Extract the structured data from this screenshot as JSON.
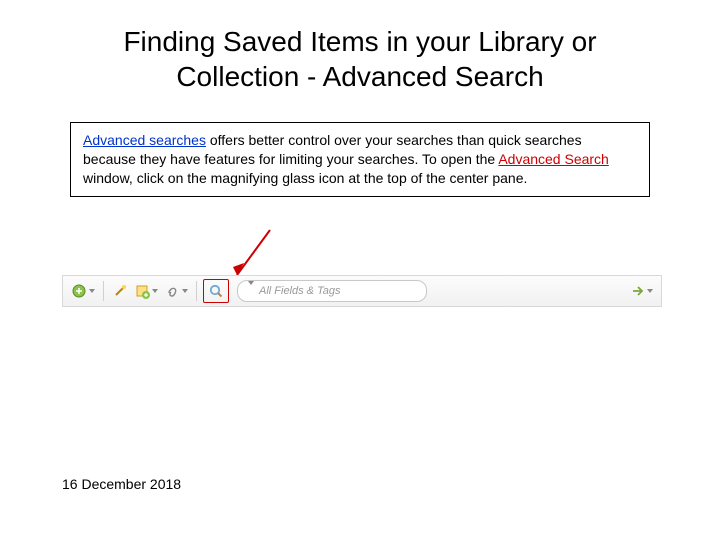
{
  "title_line1": "Finding Saved Items in your Library or",
  "title_line2": "Collection - Advanced Search",
  "desc": {
    "t1": "Advanced searches",
    "t2": " offers better control over your searches than quick searches because they have features for limiting your searches. To open the ",
    "t3": "Advanced Search",
    "t4": " window, click on the magnifying glass icon at the top of the center pane."
  },
  "toolbar": {
    "search_placeholder": "All Fields & Tags"
  },
  "date": "16 December 2018"
}
